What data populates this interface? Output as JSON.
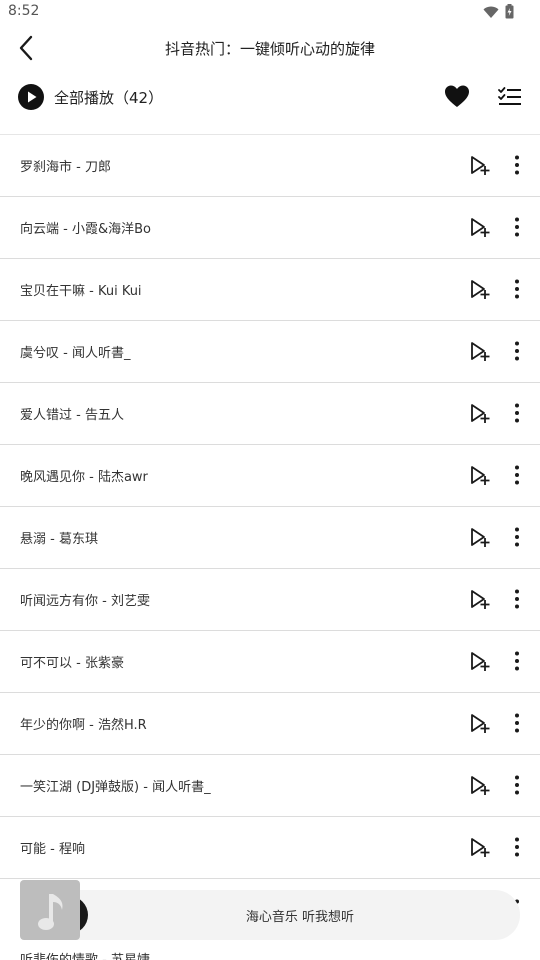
{
  "status": {
    "time": "8:52"
  },
  "header": {
    "title": "抖音热门：一键倾听心动的旋律"
  },
  "actions": {
    "play_all_label": "全部播放（42）"
  },
  "songs": [
    "罗刹海市 - 刀郎",
    "向云端 - 小霞&海洋Bo",
    "宝贝在干嘛 - Kui Kui",
    "虞兮叹 - 闻人听書_",
    "爱人错过 - 告五人",
    "晚风遇见你 - 陆杰awr",
    "悬溺 - 葛东琪",
    "听闻远方有你 - 刘艺雯",
    "可不可以 - 张紫豪",
    "年少的你啊 - 浩然H.R",
    "一笑江湖 (DJ弹鼓版) - 闻人听書_",
    "可能 - 程响",
    "",
    "听悲伤的情歌 - 苏星婕"
  ],
  "player": {
    "text": "海心音乐 听我想听"
  },
  "colors": {
    "icon": "#1a1a1a",
    "divider": "#dcdcdc"
  }
}
